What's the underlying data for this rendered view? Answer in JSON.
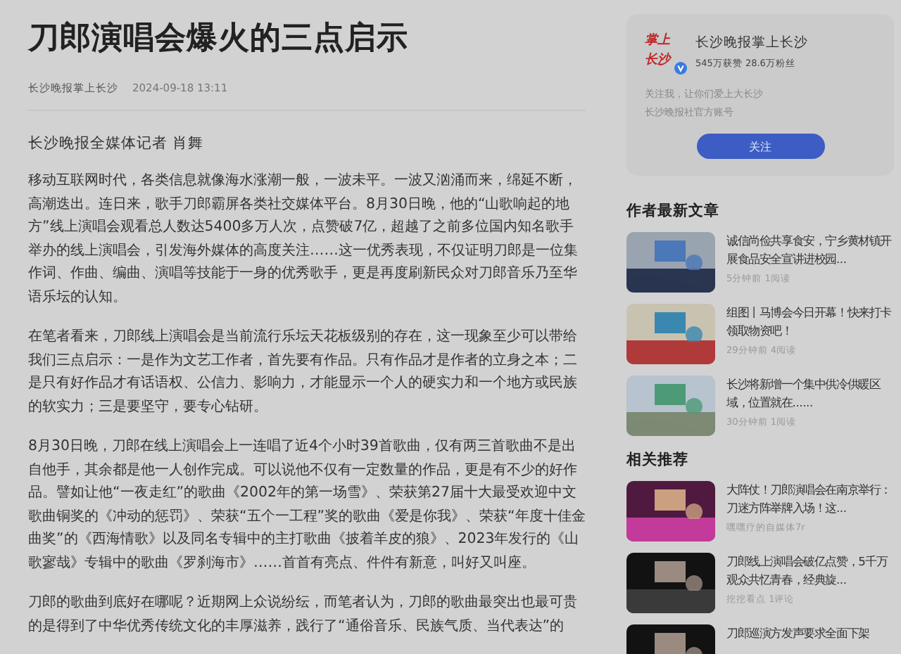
{
  "article": {
    "title": "刀郎演唱会爆火的三点启示",
    "source": "长沙晚报掌上长沙",
    "time": "2024-09-18 13:11",
    "byline": "长沙晚报全媒体记者 肖舞",
    "paragraphs": [
      "移动互联网时代，各类信息就像海水涨潮一般，一波未平。一波又汹涌而来，绵延不断，高潮迭出。连日来，歌手刀郎霸屏各类社交媒体平台。8月30日晚，他的“山歌响起的地方”线上演唱会观看总人数达5400多万人次，点赞破7亿，超越了之前多位国内知名歌手举办的线上演唱会，引发海外媒体的高度关注……这一优秀表现，不仅证明刀郎是一位集作词、作曲、编曲、演唱等技能于一身的优秀歌手，更是再度刷新民众对刀郎音乐乃至华语乐坛的认知。",
      "在笔者看来，刀郎线上演唱会是当前流行乐坛天花板级别的存在，这一现象至少可以带给我们三点启示：一是作为文艺工作者，首先要有作品。只有作品才是作者的立身之本；二是只有好作品才有话语权、公信力、影响力，才能显示一个人的硬实力和一个地方或民族的软实力；三是要坚守，要专心钻研。",
      "8月30日晚，刀郎在线上演唱会上一连唱了近4个小时39首歌曲，仅有两三首歌曲不是出自他手，其余都是他一人创作完成。可以说他不仅有一定数量的作品，更是有不少的好作品。譬如让他“一夜走红”的歌曲《2002年的第一场雪》、荣获第27届十大最受欢迎中文歌曲铜奖的《冲动的惩罚》、荣获“五个一工程”奖的歌曲《爱是你我》、荣获“年度十佳金曲奖”的《西海情歌》以及同名专辑中的主打歌曲《披着羊皮的狼》、2023年发行的《山歌寥哉》专辑中的歌曲《罗刹海市》……首首有亮点、件件有新意，叫好又叫座。",
      "刀郎的歌曲到底好在哪呢？近期网上众说纷纭，而笔者认为，刀郎的歌曲最突出也最可贵的是得到了中华优秀传统文化的丰厚滋养，践行了“通俗音乐、民族气质、当代表达”的"
    ]
  },
  "author_card": {
    "logo": [
      "掌上",
      "长沙"
    ],
    "verified": true,
    "name": "长沙晚报掌上长沙",
    "stats": "545万获赞 28.6万粉丝",
    "bio": [
      "关注我，让你们爱上大长沙",
      "长沙晚报社官方账号"
    ],
    "follow_button": "关注"
  },
  "latest": {
    "heading": "作者最新文章",
    "items": [
      {
        "title": "诚信尚俭共享食安，宁乡黄材镇开展食品安全宣讲进校园...",
        "meta": "5分钟前 1阅读",
        "kind": "hall"
      },
      {
        "title": "组图丨马博会今日开幕！快来打卡领取物资吧！",
        "meta": "29分钟前 4阅读",
        "kind": "expo"
      },
      {
        "title": "长沙将新增一个集中供冷供暖区域，位置就在......",
        "meta": "30分钟前 1阅读",
        "kind": "site"
      }
    ]
  },
  "related": {
    "heading": "相关推荐",
    "items": [
      {
        "title": "大阵仗！刀郎演唱会在南京举行：刀迷方阵举牌入场！这...",
        "meta": "嘿嘿疗的自媒体7r",
        "kind": "stage"
      },
      {
        "title": "刀郎线上演唱会破亿点赞，5千万观众共忆青春，经典旋...",
        "meta": "挖挖看点 1评论",
        "kind": "dark"
      },
      {
        "title": "刀郎巡演方发声要求全面下架",
        "kind": "dark"
      }
    ]
  }
}
